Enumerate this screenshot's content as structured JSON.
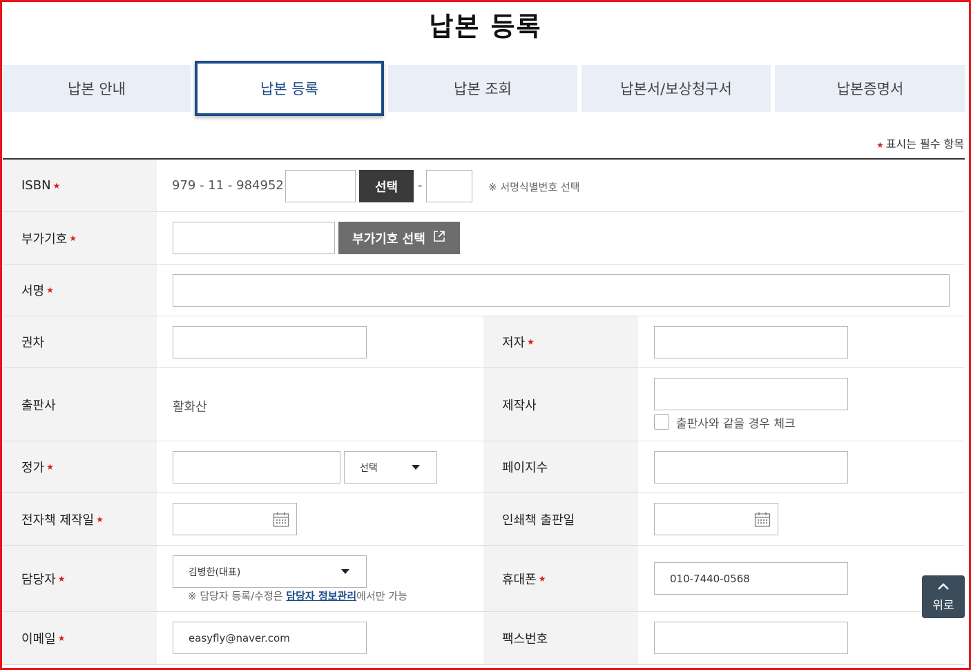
{
  "page": {
    "title": "납본 등록"
  },
  "tabs": [
    {
      "label": "납본 안내"
    },
    {
      "label": "납본 등록"
    },
    {
      "label": "납본 조회"
    },
    {
      "label": "납본서/보상청구서"
    },
    {
      "label": "납본증명서"
    }
  ],
  "required_note": "표시는 필수 항목",
  "form": {
    "isbn": {
      "label": "ISBN",
      "prefix": "979 - 11 - 984952 -",
      "dash": "-",
      "select_btn": "선택",
      "hint": "※ 서명식별번호 선택"
    },
    "addcode": {
      "label": "부가기호",
      "btn": "부가기호 선택"
    },
    "title": {
      "label": "서명"
    },
    "volume": {
      "label": "권차"
    },
    "author": {
      "label": "저자"
    },
    "publisher": {
      "label": "출판사",
      "value": "활화산"
    },
    "producer": {
      "label": "제작사",
      "check_label": "출판사와 같을 경우 체크"
    },
    "price": {
      "label": "정가",
      "currency": "선택"
    },
    "pages": {
      "label": "페이지수"
    },
    "ebook_date": {
      "label": "전자책 제작일"
    },
    "print_date": {
      "label": "인쇄책 출판일"
    },
    "manager": {
      "label": "담당자",
      "value": "김병한(대표)",
      "hint_pre": "※ 담당자 등록/수정은 ",
      "hint_link": "담당자 정보관리",
      "hint_post": "에서만 가능"
    },
    "mobile": {
      "label": "휴대폰",
      "value": "010-7440-0568"
    },
    "email": {
      "label": "이메일",
      "value": "easyfly@naver.com"
    },
    "fax": {
      "label": "팩스번호"
    }
  },
  "top_button": {
    "label": "위로"
  },
  "colors": {
    "accent": "#1d4b87",
    "required": "#d81e1e",
    "frame": "#e8141b"
  }
}
